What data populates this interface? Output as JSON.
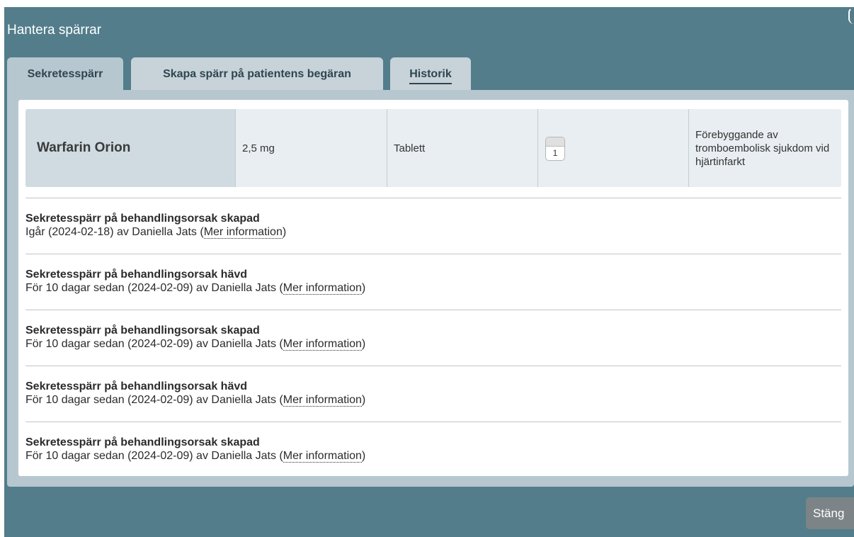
{
  "dialog": {
    "title": "Hantera spärrar",
    "close_label": "Stäng"
  },
  "tabs": [
    {
      "label": "Sekretesspärr",
      "active": true
    },
    {
      "label": "Skapa spärr på patientens begäran",
      "active": false
    },
    {
      "label": "Historik",
      "active": false
    }
  ],
  "drug": {
    "name": "Warfarin Orion",
    "strength": "2,5 mg",
    "form": "Tablett",
    "quantity": "1",
    "reason": "Förebyggande av tromboembolisk sjukdom vid hjärtinfarkt"
  },
  "history": [
    {
      "title": "Sekretesspärr på behandlingsorsak skapad",
      "when": "Igår (2024-02-18) av Daniella Jats (",
      "link": "Mer information",
      "close": ")"
    },
    {
      "title": "Sekretesspärr på behandlingsorsak hävd",
      "when": "För 10 dagar sedan (2024-02-09) av Daniella Jats (",
      "link": "Mer information",
      "close": ")"
    },
    {
      "title": "Sekretesspärr på behandlingsorsak skapad",
      "when": "För 10 dagar sedan (2024-02-09) av Daniella Jats (",
      "link": "Mer information",
      "close": ")"
    },
    {
      "title": "Sekretesspärr på behandlingsorsak hävd",
      "when": "För 10 dagar sedan (2024-02-09) av Daniella Jats (",
      "link": "Mer information",
      "close": ")"
    },
    {
      "title": "Sekretesspärr på behandlingsorsak skapad",
      "when": "För 10 dagar sedan (2024-02-09) av Daniella Jats (",
      "link": "Mer information",
      "close": ")"
    }
  ],
  "colors": {
    "dialog_bg": "#537d8b",
    "panel_bg": "#b7c7cf",
    "close_button": "#7c8487"
  }
}
